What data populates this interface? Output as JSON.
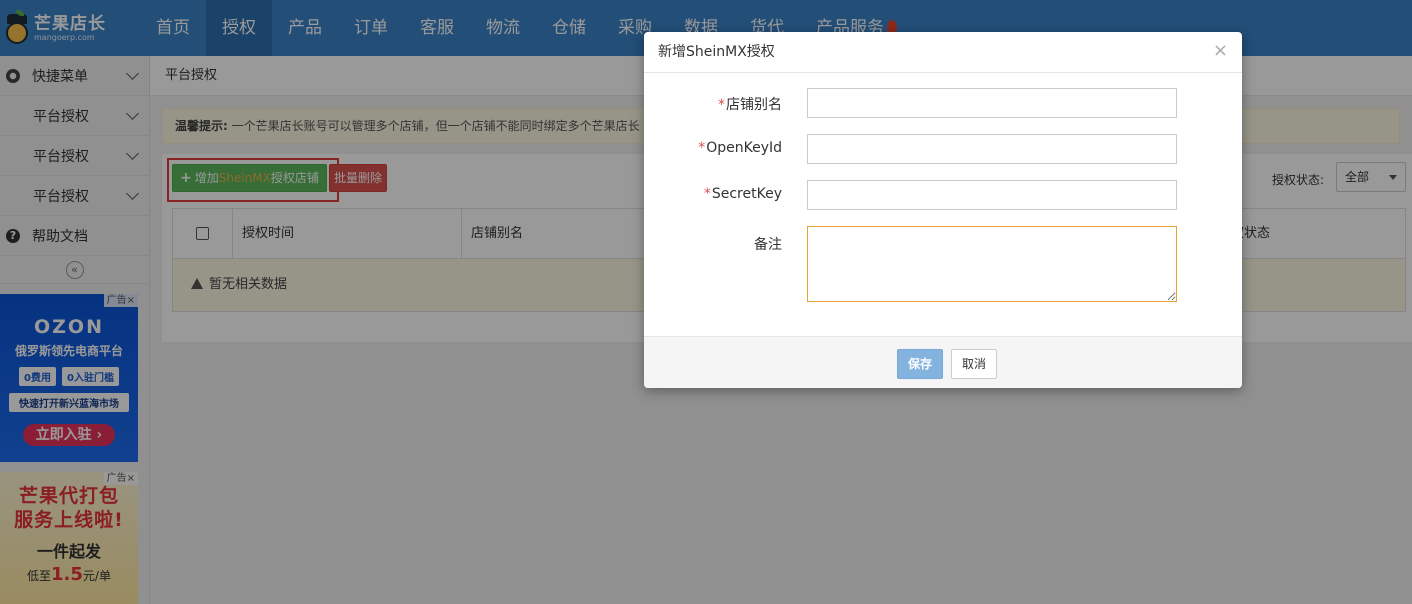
{
  "logo": {
    "name": "芒果店长",
    "domain": "mangoerp.com"
  },
  "nav": {
    "items": [
      "首页",
      "授权",
      "产品",
      "订单",
      "客服",
      "物流",
      "仓储",
      "采购",
      "数据",
      "货代",
      "产品服务"
    ],
    "active_index": 1
  },
  "sidebar": {
    "quick_menu": "快捷菜单",
    "items": [
      "平台授权",
      "平台授权",
      "平台授权"
    ],
    "help": "帮助文档",
    "collapse_glyph": "«"
  },
  "ads": {
    "tag": "广告",
    "ozon": {
      "brand": "OZON",
      "line1": "俄罗斯领先电商平台",
      "pill1": "0费用",
      "pill2": "0入驻门槛",
      "strip": "快速打开新兴蓝海市场",
      "cta": "立即入驻 ›"
    },
    "mango": {
      "line1": "芒果代打包",
      "line2": "服务上线啦!",
      "line3": "一件起发",
      "price_prefix": "低至",
      "price": "1.5",
      "price_suffix": "元/单"
    }
  },
  "main": {
    "breadcrumb": "平台授权",
    "notice_label": "温馨提示:",
    "notice_text": "一个芒果店长账号可以管理多个店铺，但一个店铺不能同时绑定多个芒果店长",
    "add_button": {
      "prefix": "增加",
      "highlight": "SheinMX",
      "suffix": "授权店铺"
    },
    "delete_button": "批量删除",
    "status_label": "授权状态:",
    "status_value": "全部",
    "columns": [
      "授权时间",
      "店铺别名",
      "权状态"
    ],
    "empty_text": "暂无相关数据"
  },
  "modal": {
    "title": "新增SheinMX授权",
    "close_glyph": "×",
    "fields": [
      {
        "label": "店铺别名",
        "required": true,
        "value": ""
      },
      {
        "label": "OpenKeyId",
        "required": true,
        "value": ""
      },
      {
        "label": "SecretKey",
        "required": true,
        "value": ""
      },
      {
        "label": "备注",
        "required": false,
        "value": ""
      }
    ],
    "save": "保存",
    "cancel": "取消"
  },
  "colors": {
    "topbar": "#3a83c9",
    "accent_green": "#5cb85c",
    "accent_red": "#d9534f",
    "save_button": "#84b3e0",
    "highlight_box": "#e23b3b"
  }
}
